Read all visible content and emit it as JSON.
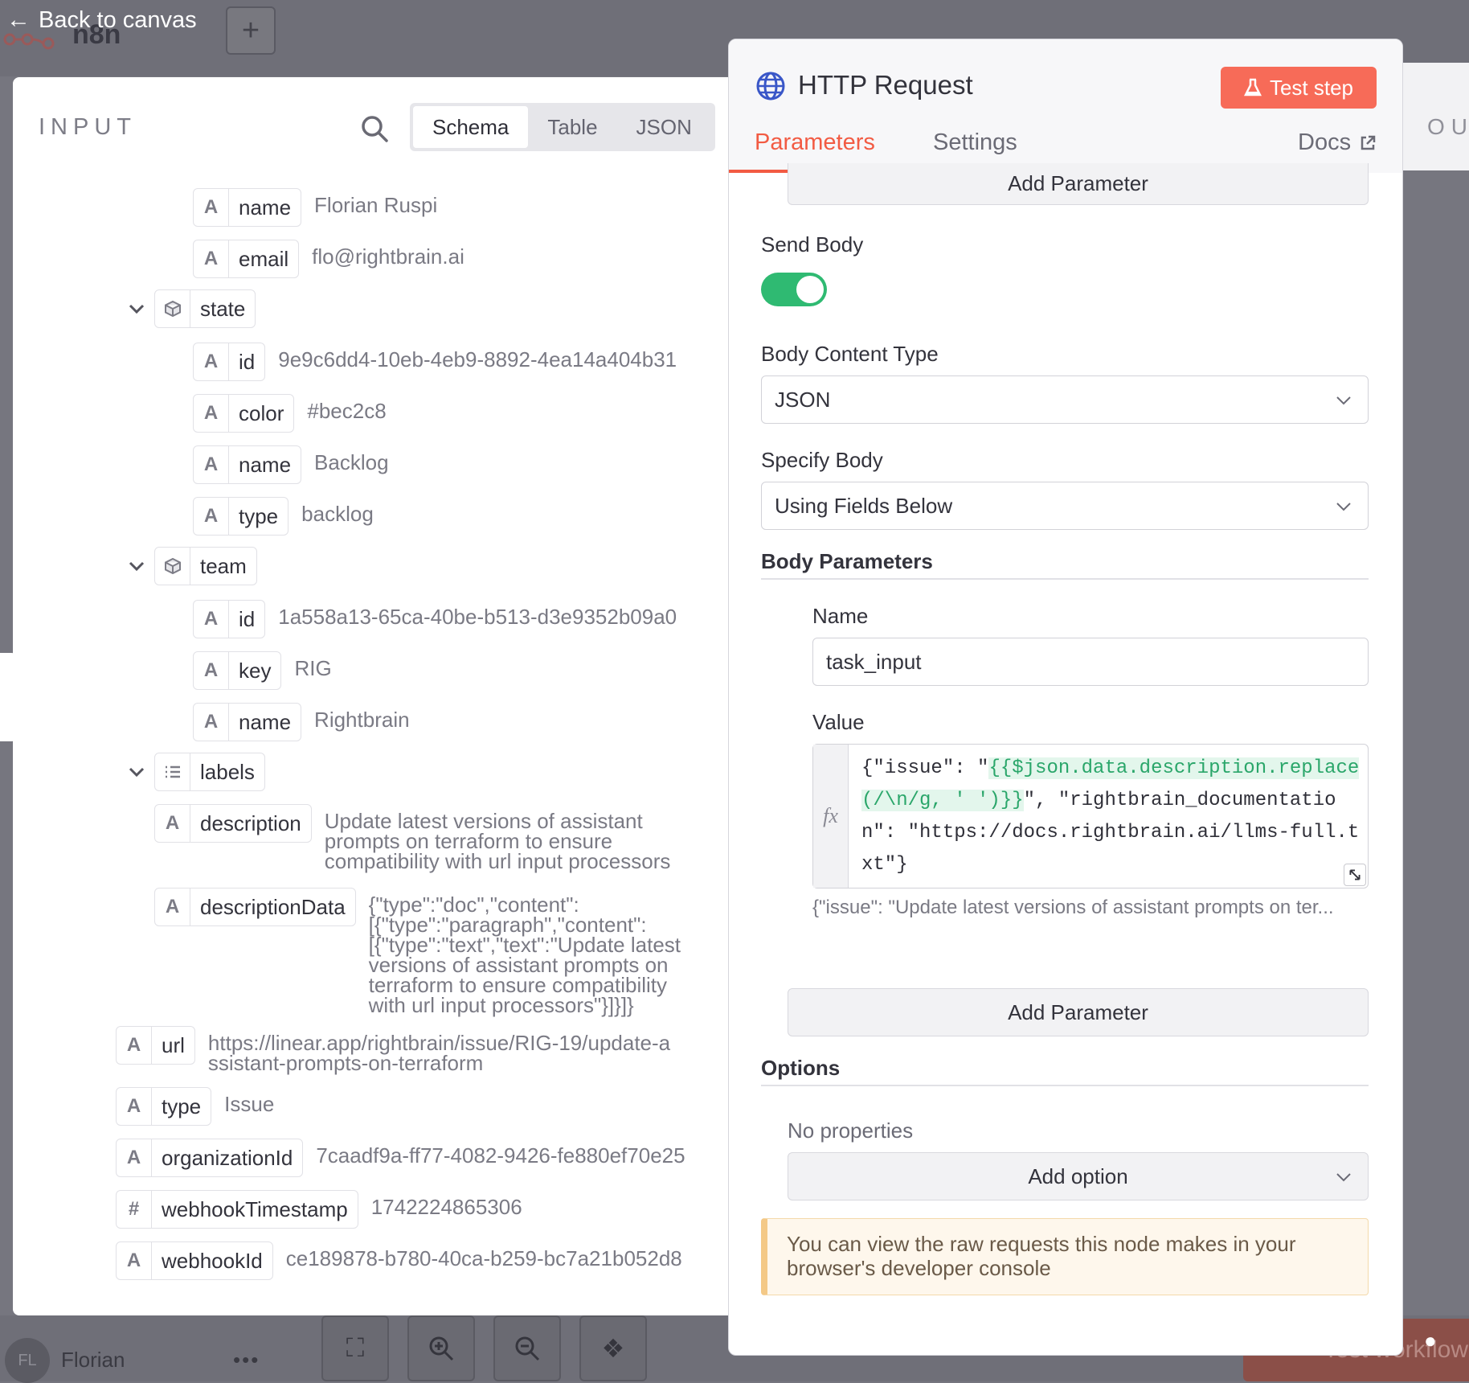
{
  "app": {
    "brand": "n8n",
    "back_label": "Back to canvas"
  },
  "input_panel": {
    "title": "INPUT",
    "view_tabs": [
      "Schema",
      "Table",
      "JSON"
    ],
    "active_view": "Schema",
    "fields": {
      "name": {
        "key": "name",
        "value": "Florian Ruspi"
      },
      "email": {
        "key": "email",
        "value": "flo@rightbrain.ai"
      },
      "state": {
        "key": "state"
      },
      "state_id": {
        "key": "id",
        "value": "9e9c6dd4-10eb-4eb9-8892-4ea14a404b31"
      },
      "state_color": {
        "key": "color",
        "value": "#bec2c8"
      },
      "state_name": {
        "key": "name",
        "value": "Backlog"
      },
      "state_type": {
        "key": "type",
        "value": "backlog"
      },
      "team": {
        "key": "team"
      },
      "team_id": {
        "key": "id",
        "value": "1a558a13-65ca-40be-b513-d3e9352b09a0"
      },
      "team_key": {
        "key": "key",
        "value": "RIG"
      },
      "team_name": {
        "key": "name",
        "value": "Rightbrain"
      },
      "labels": {
        "key": "labels"
      },
      "description": {
        "key": "description",
        "value": "Update latest versions of assistant prompts on terraform to ensure compatibility with url input processors"
      },
      "descriptionData": {
        "key": "descriptionData",
        "value": "{\"type\":\"doc\",\"content\":[{\"type\":\"paragraph\",\"content\":[{\"type\":\"text\",\"text\":\"Update latest versions of assistant prompts on terraform to ensure compatibility with url input processors\"}]}]}"
      },
      "url": {
        "key": "url",
        "value": "https://linear.app/rightbrain/issue/RIG-19/update-assistant-prompts-on-terraform"
      },
      "type": {
        "key": "type",
        "value": "Issue"
      },
      "organizationId": {
        "key": "organizationId",
        "value": "7caadf9a-ff77-4082-9426-fe880ef70e25"
      },
      "webhookTimestamp": {
        "key": "webhookTimestamp",
        "value": "1742224865306"
      },
      "webhookId": {
        "key": "webhookId",
        "value": "ce189878-b780-40ca-b259-bc7a21b052d8"
      }
    },
    "type_glyphs": {
      "string": "A",
      "number": "#"
    }
  },
  "node_panel": {
    "title": "HTTP Request",
    "test_label": "Test step",
    "tabs": [
      "Parameters",
      "Settings"
    ],
    "active_tab": "Parameters",
    "docs_label": "Docs",
    "add_parameter_top": "Add Parameter",
    "send_body_label": "Send Body",
    "send_body_enabled": true,
    "body_content_type_label": "Body Content Type",
    "body_content_type_value": "JSON",
    "specify_body_label": "Specify Body",
    "specify_body_value": "Using Fields Below",
    "body_parameters_label": "Body Parameters",
    "name_label": "Name",
    "name_value": "task_input",
    "value_label": "Value",
    "value_code_prefix": "{\"issue\": \"",
    "value_code_expr": "{{$json.data.description.replace(/\\n/g, ' ')}}",
    "value_code_suffix": "\", \"rightbrain_documentation\": \"https://docs.rightbrain.ai/llms-full.txt\"}",
    "fx_label": "fx",
    "value_preview": "{\"issue\": \"Update latest versions of assistant prompts on ter...",
    "add_parameter_bottom": "Add Parameter",
    "options_label": "Options",
    "no_properties": "No properties",
    "add_option_label": "Add option",
    "notice": "You can view the raw requests this node makes in your browser's developer console"
  },
  "output_label": "OU",
  "footer": {
    "avatar_initials": "FL",
    "username": "Florian",
    "more": "•••",
    "execute_label": "Test workflow"
  },
  "colors": {
    "accent": "#f25b43",
    "test_button": "#f76b58",
    "toggle_on": "#2fba72",
    "expression": "#2aa66a"
  },
  "icons": {
    "back": "arrow-left-icon",
    "plus": "plus-icon",
    "search": "search-icon",
    "globe": "globe-icon",
    "flask": "flask-icon",
    "external": "external-link-icon",
    "chevron": "chevron-down-icon",
    "object": "cube-icon",
    "list": "list-icon",
    "resize": "resize-icon",
    "fit": "fit-view-icon",
    "zoom_in": "zoom-in-icon",
    "zoom_out": "zoom-out-icon",
    "clean": "broom-icon",
    "bulb": "lightbulb-icon"
  }
}
